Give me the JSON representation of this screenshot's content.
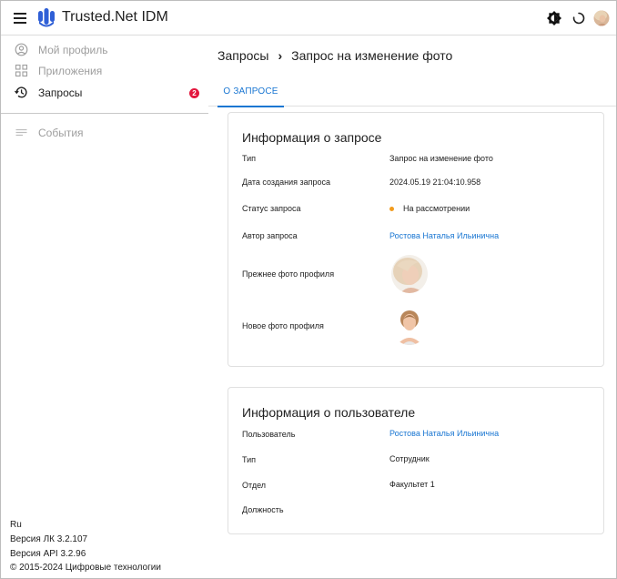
{
  "header": {
    "app_title": "Trusted.Net IDM",
    "icons": [
      "menu-icon",
      "trusted-logo-icon",
      "theme-toggle-icon",
      "loading-spinner-icon",
      "user-avatar"
    ]
  },
  "sidebar": {
    "items": [
      {
        "label": "Мой профиль",
        "icon": "profile-icon"
      },
      {
        "label": "Приложения",
        "icon": "apps-grid-icon"
      },
      {
        "label": "Запросы",
        "icon": "history-icon",
        "badge": "2"
      },
      {
        "label": "События",
        "icon": "events-list-icon"
      }
    ],
    "footer": {
      "lang": "Ru",
      "version_lk": "Версия ЛК 3.2.107",
      "version_api": "Версия API 3.2.96",
      "copyright": "© 2015-2024 Цифровые технологии"
    }
  },
  "breadcrumb": {
    "parent": "Запросы",
    "separator": "›",
    "current": "Запрос на изменение фото"
  },
  "tabs": [
    {
      "label": "О ЗАПРОСЕ",
      "active": true
    }
  ],
  "request_card": {
    "title": "Информация о запросе",
    "rows": [
      {
        "label": "Тип",
        "value": "Запрос на изменение фото"
      },
      {
        "label": "Дата создания запроса",
        "value": "2024.05.19 21:04:10.958"
      },
      {
        "label": "Статус запроса",
        "value": "На рассмотрении"
      },
      {
        "label": "Автор запроса",
        "value": "Ростова Наталья Ильинична"
      },
      {
        "label": "Прежнее фото профиля"
      },
      {
        "label": "Новое фото профиля"
      }
    ]
  },
  "user_card": {
    "title": "Информация о пользователе",
    "rows": [
      {
        "label": "Пользователь",
        "value": "Ростова Наталья Ильинична"
      },
      {
        "label": "Тип",
        "value": "Сотрудник"
      },
      {
        "label": "Отдел",
        "value": "Факультет 1"
      },
      {
        "label": "Должность",
        "value": ""
      }
    ]
  },
  "colors": {
    "accent": "#1976d2",
    "badge": "#e3173e",
    "status_pending": "#f29b1d",
    "logo": "#2f5fd6"
  }
}
